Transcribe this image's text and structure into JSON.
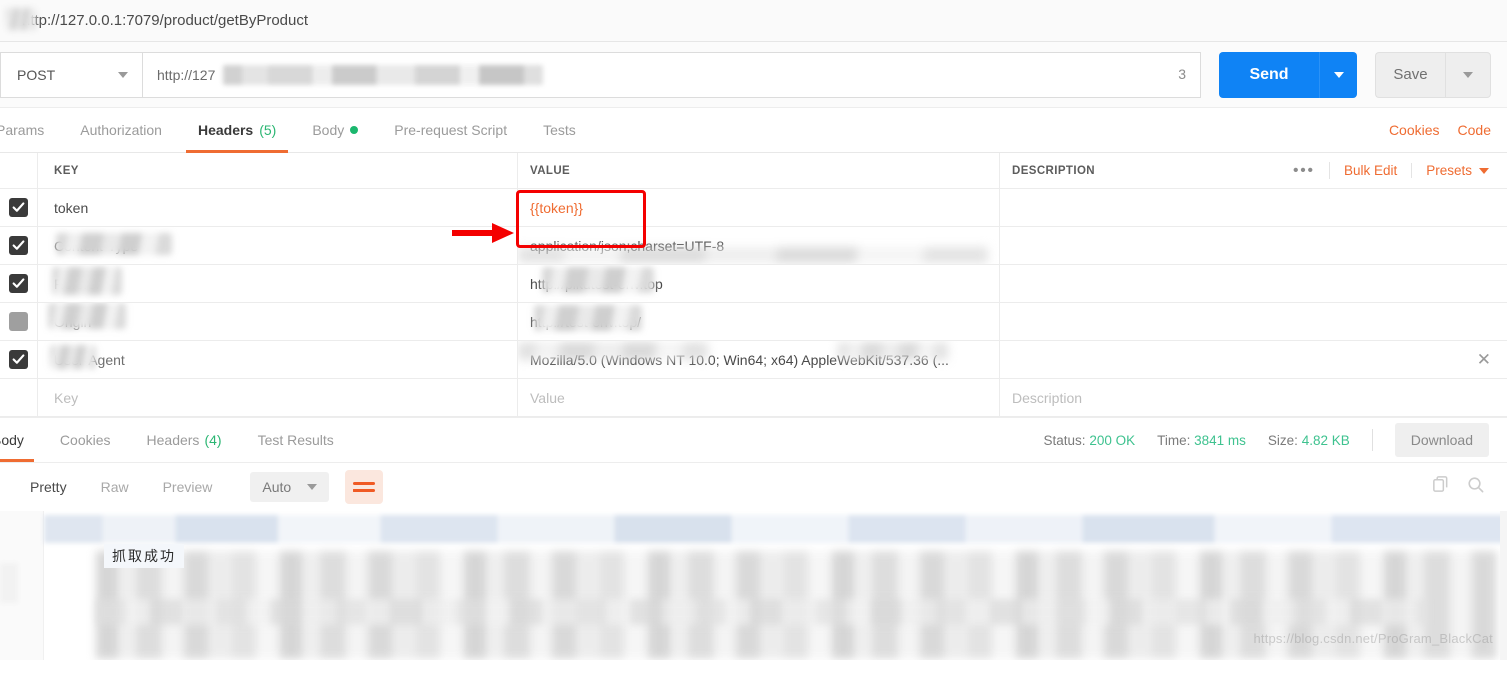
{
  "titlebar": {
    "url": "http://127.0.0.1:7079/product/getByProduct"
  },
  "request": {
    "method": "POST",
    "url_visible_prefix": "http://127",
    "url_tail": "3",
    "send_label": "Send",
    "save_label": "Save"
  },
  "request_tabs": [
    {
      "label": "Params",
      "active": false
    },
    {
      "label": "Authorization",
      "active": false
    },
    {
      "label": "Headers",
      "count": "(5)",
      "active": true
    },
    {
      "label": "Body",
      "dot": true,
      "active": false
    },
    {
      "label": "Pre-request Script",
      "active": false
    },
    {
      "label": "Tests",
      "active": false
    }
  ],
  "tabs_right": {
    "cookies": "Cookies",
    "code": "Code"
  },
  "headers_table": {
    "columns": {
      "key": "KEY",
      "value": "VALUE",
      "description": "DESCRIPTION"
    },
    "actions": {
      "dots": "•••",
      "bulk_edit": "Bulk Edit",
      "presets": "Presets"
    },
    "rows": [
      {
        "checked": true,
        "key": "token",
        "value": "{{token}}",
        "value_is_variable": true,
        "description": "",
        "redacted_key": false,
        "redacted_value": false
      },
      {
        "checked": true,
        "key": "Content-Type",
        "value": "application/json;charset=UTF-8",
        "description": "",
        "redacted_key": true,
        "redacted_value": true
      },
      {
        "checked": true,
        "key": "Referer",
        "value": "http://pikutest-env.top",
        "description": "",
        "redacted_key": true,
        "redacted_value": true
      },
      {
        "checked": false,
        "key": "Origin",
        "value": "http://test-env.top/",
        "description": "",
        "redacted_key": true,
        "redacted_value": true
      },
      {
        "checked": true,
        "key": "User-Agent",
        "value": "Mozilla/5.0 (Windows NT 10.0; Win64; x64) AppleWebKit/537.36 (...",
        "description": "",
        "redacted_key": true,
        "redacted_value": true,
        "show_delete": true
      }
    ],
    "new_row": {
      "key_placeholder": "Key",
      "value_placeholder": "Value",
      "description_placeholder": "Description"
    }
  },
  "response_tabs": [
    {
      "label": "Body",
      "active": true
    },
    {
      "label": "Cookies",
      "active": false
    },
    {
      "label": "Headers",
      "count": "(4)",
      "active": false
    },
    {
      "label": "Test Results",
      "active": false
    }
  ],
  "response_meta": {
    "status_label": "Status:",
    "status_value": "200 OK",
    "time_label": "Time:",
    "time_value": "3841 ms",
    "size_label": "Size:",
    "size_value": "4.82 KB",
    "download_label": "Download"
  },
  "body_toolbar": {
    "views": [
      {
        "label": "Pretty",
        "active": true
      },
      {
        "label": "Raw",
        "active": false
      },
      {
        "label": "Preview",
        "active": false
      }
    ],
    "format_select": "Auto"
  },
  "body_content": {
    "toast": "抓取成功"
  },
  "watermark": "https://blog.csdn.net/ProGram_BlackCat",
  "colors": {
    "accent_orange": "#ef6c32",
    "send_blue": "#0f83f5",
    "status_green": "#3ec28f",
    "annotation_red": "#f40000"
  }
}
